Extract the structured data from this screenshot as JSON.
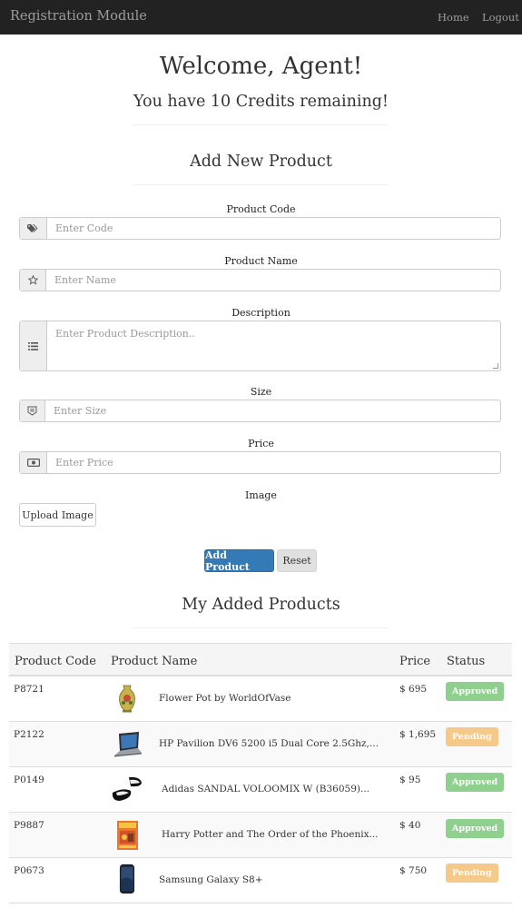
{
  "navbar": {
    "brand": "Registration Module",
    "home": "Home",
    "logout": "Logout"
  },
  "header": {
    "welcome": "Welcome, Agent!",
    "credits": "You have 10 Credits remaining!"
  },
  "form": {
    "title": "Add New Product",
    "code_label": "Product Code",
    "code_placeholder": "Enter Code",
    "code_icon": "tags-icon",
    "name_label": "Product Name",
    "name_placeholder": "Enter Name",
    "name_icon": "star-icon",
    "desc_label": "Description",
    "desc_placeholder": "Enter Product Description..",
    "desc_icon": "list-icon",
    "size_label": "Size",
    "size_placeholder": "Enter Size",
    "size_icon": "size-icon",
    "price_label": "Price",
    "price_placeholder": "Enter Price",
    "price_icon": "money-icon",
    "image_label": "Image",
    "upload_label": "Upload Image",
    "add_label": "Add Product",
    "reset_label": "Reset"
  },
  "products": {
    "title": "My Added Products",
    "columns": [
      "Product Code",
      "Product Name",
      "Price",
      "Status"
    ],
    "rows": [
      {
        "code": "P8721",
        "name": "Flower Pot by WorldOfVase",
        "price": "$ 695",
        "status": "Approved",
        "image": "vase-image"
      },
      {
        "code": "P2122",
        "name": "HP Pavilion DV6 5200 i5 Dual Core 2.5Ghz,...",
        "price": "$ 1,695",
        "status": "Pending",
        "image": "laptop-image"
      },
      {
        "code": "P0149",
        "name": "Adidas SANDAL VOLOOMIX W (B36059)...",
        "price": "$ 95",
        "status": "Approved",
        "image": "sandal-image"
      },
      {
        "code": "P9887",
        "name": "Harry Potter and The Order of the Phoenix...",
        "price": "$ 40",
        "status": "Approved",
        "image": "book-image"
      },
      {
        "code": "P0673",
        "name": "Samsung Galaxy S8+",
        "price": "$ 750",
        "status": "Pending",
        "image": "phone-image"
      }
    ]
  },
  "colors": {
    "navbar": "#222222",
    "primary": "#337ab7",
    "approved": "#8fd08f",
    "pending": "#f5c98a"
  }
}
